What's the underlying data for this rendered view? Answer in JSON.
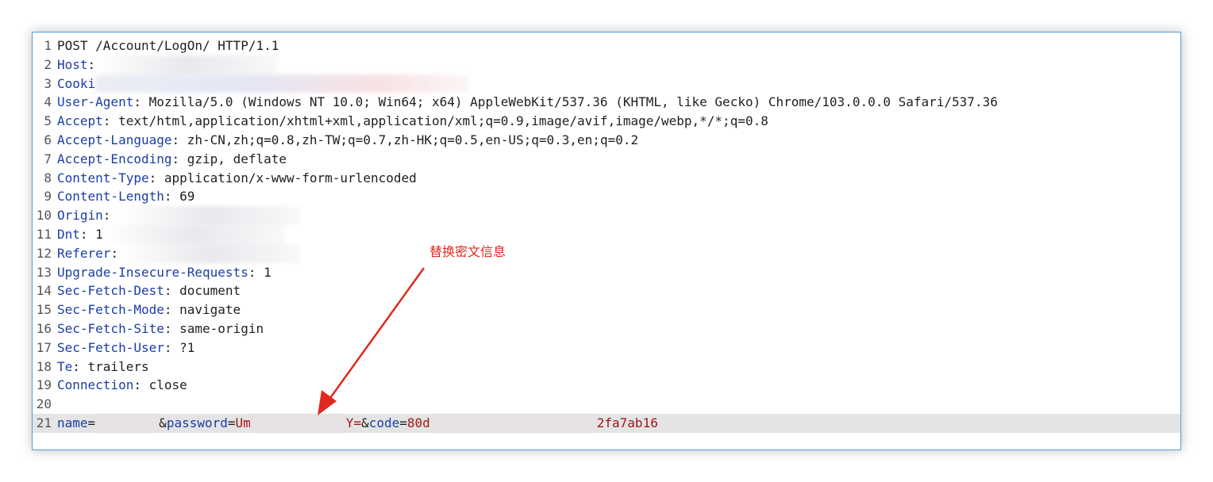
{
  "request": {
    "lines": [
      {
        "n": "1",
        "k": "",
        "v": "POST /Account/LogOn/ HTTP/1.1",
        "redact": ""
      },
      {
        "n": "2",
        "k": "Host",
        "v": ":",
        "redact": "a"
      },
      {
        "n": "3",
        "k": "Cooki",
        "v": "",
        "redact": "cookie"
      },
      {
        "n": "4",
        "k": "User-Agent",
        "v": ": Mozilla/5.0 (Windows NT 10.0; Win64; x64) AppleWebKit/537.36 (KHTML, like Gecko) Chrome/103.0.0.0 Safari/537.36",
        "redact": ""
      },
      {
        "n": "5",
        "k": "Accept",
        "v": ": text/html,application/xhtml+xml,application/xml;q=0.9,image/avif,image/webp,*/*;q=0.8",
        "redact": ""
      },
      {
        "n": "6",
        "k": "Accept-Language",
        "v": ": zh-CN,zh;q=0.8,zh-TW;q=0.7,zh-HK;q=0.5,en-US;q=0.3,en;q=0.2",
        "redact": ""
      },
      {
        "n": "7",
        "k": "Accept-Encoding",
        "v": ": gzip, deflate",
        "redact": ""
      },
      {
        "n": "8",
        "k": "Content-Type",
        "v": ": application/x-www-form-urlencoded",
        "redact": ""
      },
      {
        "n": "9",
        "k": "Content-Length",
        "v": ": 69",
        "redact": ""
      },
      {
        "n": "10",
        "k": "Origin",
        "v": ": ",
        "redact": "a"
      },
      {
        "n": "11",
        "k": "Dnt",
        "v": ": 1",
        "redact": "a"
      },
      {
        "n": "12",
        "k": "Referer",
        "v": ":",
        "redact": "a"
      },
      {
        "n": "13",
        "k": "Upgrade-Insecure-Requests",
        "v": ": 1",
        "redact": ""
      },
      {
        "n": "14",
        "k": "Sec-Fetch-Dest",
        "v": ": document",
        "redact": ""
      },
      {
        "n": "15",
        "k": "Sec-Fetch-Mode",
        "v": ": navigate",
        "redact": ""
      },
      {
        "n": "16",
        "k": "Sec-Fetch-Site",
        "v": ": same-origin",
        "redact": ""
      },
      {
        "n": "17",
        "k": "Sec-Fetch-User",
        "v": ": ?1",
        "redact": ""
      },
      {
        "n": "18",
        "k": "Te",
        "v": ": trailers",
        "redact": ""
      },
      {
        "n": "19",
        "k": "Connection",
        "v": ": close",
        "redact": ""
      },
      {
        "n": "20",
        "k": "",
        "v": "",
        "redact": ""
      }
    ],
    "body": {
      "n": "21",
      "name_key": "name",
      "eq": "=",
      "amp_password": "&",
      "password_key": "password",
      "password_prefix": "Um",
      "password_suffix": "Y=",
      "amp_code": "&",
      "code_key": "code",
      "code_prefix": "80d",
      "code_suffix": "2fa7ab16"
    }
  },
  "annotation": {
    "text": "替换密文信息",
    "color": "#e0291e"
  },
  "colors": {
    "header_key": "#1a3da8",
    "param_value": "#a31515",
    "highlight_row": "#e4e4e4",
    "frame_border": "#5a9bd5"
  }
}
